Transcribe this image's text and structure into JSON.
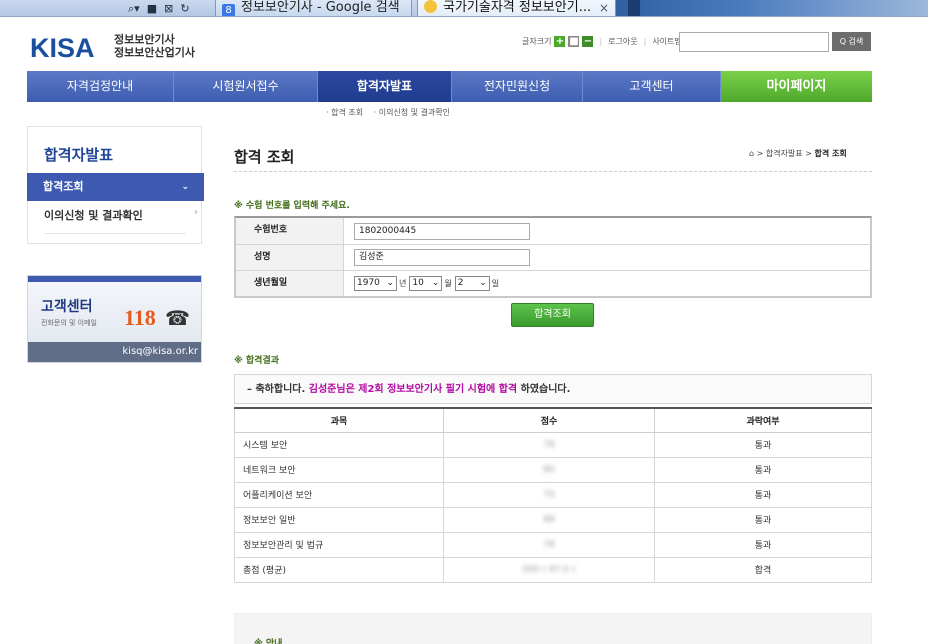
{
  "browser": {
    "toolbar_icons": [
      "⌕▾",
      "■",
      "⊠",
      "↻"
    ],
    "tabs": [
      {
        "label": "정보보안기사 - Google 검색",
        "favicon": "8"
      },
      {
        "label": "국가기술자격 정보보안기...",
        "close": "×"
      }
    ]
  },
  "header": {
    "logo": "KISA",
    "logo_sub1": "정보보안기사",
    "logo_sub2": "정보보안산업기사",
    "font_size_label": "글자크기",
    "font_plus": "+",
    "font_mid": "■",
    "font_minus": "−",
    "logout": "로그아웃",
    "sitemap": "사이트맵",
    "search_placeholder": "",
    "search_button": "Q 검색"
  },
  "nav": {
    "items": [
      {
        "label": "자격검정안내"
      },
      {
        "label": "시험원서접수"
      },
      {
        "label": "합격자발표"
      },
      {
        "label": "전자민원신청"
      },
      {
        "label": "고객센터"
      },
      {
        "label": "마이페이지"
      }
    ],
    "sub": [
      "· 합격 조회",
      "· 이의신청 및 결과확인"
    ]
  },
  "sidebar": {
    "title": "합격자발표",
    "active_item": "합격조회",
    "item": "이의신청 및 결과확인",
    "chevron_down": "⌄",
    "chevron_right": "›"
  },
  "cs_banner": {
    "title": "고객센터",
    "sub": "전화문의 및 이메일",
    "number": "118",
    "phone_icon": "☎",
    "email": "kisq@kisa.or.kr"
  },
  "content": {
    "title": "합격 조회",
    "breadcrumb_home": "⌂",
    "breadcrumb": "> 합격자발표 >",
    "breadcrumb_current": "합격 조회",
    "section_input": "※ 수험 번호를 입력해 주세요.",
    "form": {
      "exam_no_label": "수험번호",
      "exam_no_value": "1802000445",
      "name_label": "성명",
      "name_value": "김성준",
      "dob_label": "생년월일",
      "year": "1970",
      "year_unit": "년",
      "month": "10",
      "month_unit": "월",
      "day": "2",
      "day_unit": "일",
      "select_arrow": "⌄"
    },
    "check_button": "합격조회",
    "section_result": "※ 합격결과",
    "result_prefix": "– 축하합니다.",
    "result_highlight": "김성준님은 제2회 정보보안기사 필기 시험에 합격",
    "result_suffix": "하였습니다.",
    "table": {
      "headers": [
        "과목",
        "점수",
        "과락여부"
      ],
      "rows": [
        {
          "subject": "시스템 보안",
          "score": "78",
          "pass": "통과"
        },
        {
          "subject": "네트워크 보안",
          "score": "80",
          "pass": "통과"
        },
        {
          "subject": "어플리케이션 보안",
          "score": "70",
          "pass": "통과"
        },
        {
          "subject": "정보보안 일반",
          "score": "88",
          "pass": "통과"
        },
        {
          "subject": "정보보안관리 및 법규",
          "score": "78",
          "pass": "통과"
        },
        {
          "subject": "총점 (평균)",
          "score": "000 ( 87.0 )",
          "pass": "합격"
        }
      ]
    },
    "section_guide": "※ 안내"
  }
}
